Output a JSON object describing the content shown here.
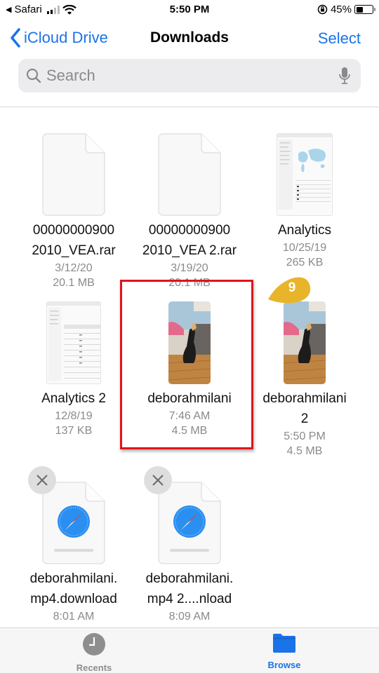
{
  "status_bar": {
    "back_app": "Safari",
    "time": "5:50 PM",
    "battery_percent": "45%",
    "battery_level": 0.45,
    "signal_bars_active": 2,
    "signal_bars_total": 4
  },
  "nav": {
    "back_label": "iCloud Drive",
    "title": "Downloads",
    "select_label": "Select"
  },
  "search": {
    "placeholder": "Search"
  },
  "files": [
    {
      "name_line1": "00000000900",
      "name_line2": "2010_VEA.rar",
      "date": "3/12/20",
      "size": "20.1 MB",
      "icon": "generic-document-icon"
    },
    {
      "name_line1": "00000000900",
      "name_line2": "2010_VEA 2.rar",
      "date": "3/19/20",
      "size": "20.1 MB",
      "icon": "generic-document-icon"
    },
    {
      "name_line1": "Analytics",
      "date": "10/25/19",
      "size": "265 KB",
      "icon": "analytics-screenshot-thumbnail"
    },
    {
      "name_line1": "Analytics 2",
      "date": "12/8/19",
      "size": "137 KB",
      "icon": "analytics-table-screenshot-thumbnail"
    },
    {
      "name_line1": "deborahmilani",
      "date": "7:46 AM",
      "size": "4.5 MB",
      "icon": "video-thumbnail"
    },
    {
      "name_line1": "deborahmilani",
      "name_line2": "2",
      "date": "5:50 PM",
      "size": "4.5 MB",
      "icon": "video-thumbnail"
    },
    {
      "name_line1": "deborahmilani.",
      "name_line2": "mp4.download",
      "date": "8:01 AM",
      "icon": "safari-download-icon"
    },
    {
      "name_line1": "deborahmilani.",
      "name_line2": "mp4 2....nload",
      "date": "8:09 AM",
      "icon": "safari-download-icon"
    }
  ],
  "annotation": {
    "step_number": "9",
    "highlight_color": "#e0141b",
    "marker_color": "#e8b42a"
  },
  "tabs": [
    {
      "label": "Recents",
      "icon": "clock-icon",
      "active": false
    },
    {
      "label": "Browse",
      "icon": "folder-icon",
      "active": true
    }
  ],
  "colors": {
    "accent": "#1a73e8",
    "secondary_text": "#8a8a8e"
  }
}
